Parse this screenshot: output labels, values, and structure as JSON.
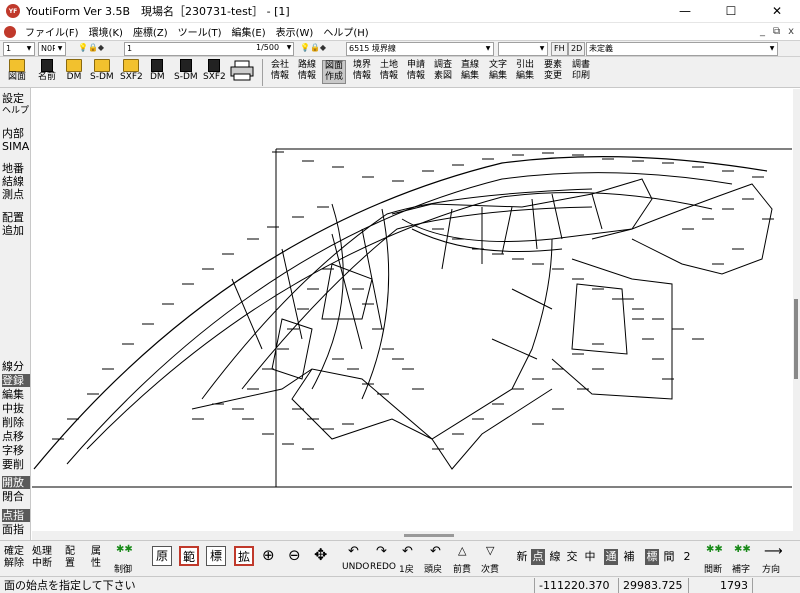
{
  "window": {
    "title": "YoutiForm Ver 3.5B　現場名［230731-test］ - [1]",
    "minimize": "—",
    "maximize": "☐",
    "close": "✕",
    "app_icon_text": "YF"
  },
  "menu": {
    "items": [
      "ファイル(F)",
      "環境(K)",
      "座標(Z)",
      "ツール(T)",
      "編集(E)",
      "表示(W)",
      "ヘルプ(H)"
    ],
    "mdi_controls": [
      "_",
      "⧉",
      "x"
    ]
  },
  "selbar": {
    "layer_combo": "1",
    "mode_combo": "N0R",
    "sheet_combo": "1",
    "scale_combo": "1/500",
    "line_combo": "6515 境界線",
    "blank_combo": "",
    "fh_label": "FH",
    "twod_label": "2D",
    "undefined_combo": "未定義"
  },
  "toolbar": {
    "file_buttons": [
      "図面",
      "名前",
      "DM",
      "S-DM",
      "SXF2",
      "DM",
      "S-DM",
      "SXF2"
    ],
    "text_buttons": [
      [
        "会社",
        "情報"
      ],
      [
        "路線",
        "情報"
      ],
      [
        "図面",
        "作成"
      ],
      [
        "境界",
        "情報"
      ],
      [
        "土地",
        "情報"
      ],
      [
        "申請",
        "情報"
      ],
      [
        "調査",
        "素図"
      ],
      [
        "直線",
        "編集"
      ],
      [
        "文字",
        "編集"
      ],
      [
        "引出",
        "編集"
      ],
      [
        "要素",
        "変更"
      ],
      [
        "調書",
        "印刷"
      ]
    ]
  },
  "sidebar": {
    "items": [
      [
        "設定",
        "ヘルプ"
      ],
      [
        "内部",
        "SIMA"
      ],
      [
        "地番",
        "結線",
        "測点"
      ],
      [
        "配置",
        "追加"
      ],
      [
        "線分"
      ],
      [
        "登録"
      ],
      [
        "編集"
      ],
      [
        "中抜"
      ],
      [
        "削除"
      ],
      [
        "点移"
      ],
      [
        "字移"
      ],
      [
        "要削"
      ],
      [
        "開放"
      ],
      [
        "閉合"
      ],
      [
        "点指"
      ],
      [
        "面指"
      ]
    ]
  },
  "bottombar": {
    "kakutei": [
      "確定",
      "解除"
    ],
    "shori": [
      "処理",
      "中断"
    ],
    "haichi": [
      "配",
      "置"
    ],
    "zokusei": [
      "属",
      "性"
    ],
    "seigyo": "制御",
    "boxes": [
      "原",
      "範",
      "標",
      "拡"
    ],
    "undo": "UNDO",
    "redo": "REDO",
    "modoru": "1戻",
    "tomodoru": "頭戻",
    "maedama": "前貫",
    "jidama": "次貫",
    "modes": [
      "新",
      "点",
      "線",
      "交",
      "中",
      "通",
      "補",
      "標",
      "間",
      "2"
    ],
    "kanbetsu": "間断",
    "hojo": "補字",
    "houkou": "方向"
  },
  "status": {
    "message": "面の始点を指定して下さい",
    "x_coord": "-111220.370",
    "y_coord": "29983.725",
    "count": "1793"
  }
}
